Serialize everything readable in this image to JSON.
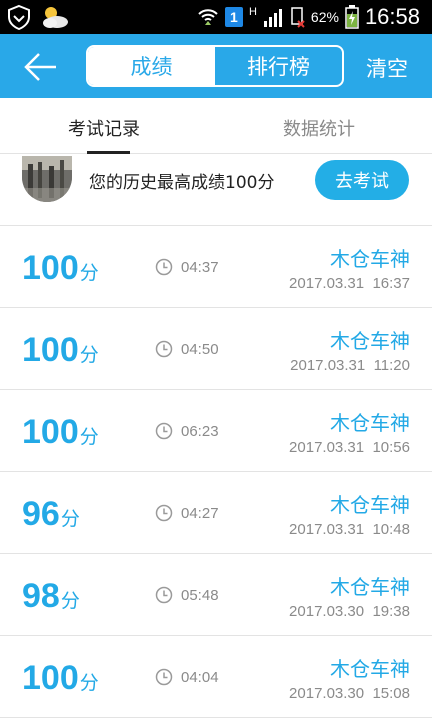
{
  "status_bar": {
    "icons": [
      "shield-icon",
      "weather-icon",
      "wifi-icon",
      "sim-icon",
      "signal-icon",
      "battery-icon"
    ],
    "sim_label": "1",
    "network_type": "H",
    "battery_percent": "62%",
    "time": "16:58"
  },
  "header": {
    "back_icon": "back-arrow-icon",
    "tabs": [
      {
        "label": "成绩",
        "active": true
      },
      {
        "label": "排行榜",
        "active": false
      }
    ],
    "clear_label": "清空"
  },
  "sub_tabs": [
    {
      "label": "考试记录",
      "active": true
    },
    {
      "label": "数据统计",
      "active": false
    }
  ],
  "best": {
    "text": "您的历史最高成绩100分",
    "button_label": "去考试"
  },
  "records": [
    {
      "score": "100",
      "unit": "分",
      "duration": "04:37",
      "name": "木仓车神",
      "datetime": "2017.03.31  16:37"
    },
    {
      "score": "100",
      "unit": "分",
      "duration": "04:50",
      "name": "木仓车神",
      "datetime": "2017.03.31  11:20"
    },
    {
      "score": "100",
      "unit": "分",
      "duration": "06:23",
      "name": "木仓车神",
      "datetime": "2017.03.31  10:56"
    },
    {
      "score": "96",
      "unit": "分",
      "duration": "04:27",
      "name": "木仓车神",
      "datetime": "2017.03.31  10:48"
    },
    {
      "score": "98",
      "unit": "分",
      "duration": "05:48",
      "name": "木仓车神",
      "datetime": "2017.03.30  19:38"
    },
    {
      "score": "100",
      "unit": "分",
      "duration": "04:04",
      "name": "木仓车神",
      "datetime": "2017.03.30  15:08"
    }
  ],
  "colors": {
    "accent": "#29a8e8",
    "score": "#23a9e6",
    "muted": "#8a8a8a",
    "divider": "#e3e3e3"
  }
}
